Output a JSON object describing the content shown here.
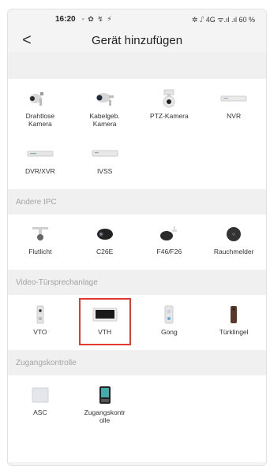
{
  "status_bar": {
    "time": "16:20",
    "left_icons": "◦ ✿ ↯ ⚡",
    "right_text": "✲ ⑀ 4G ᯤ.ıl .ıl 60 %"
  },
  "header": {
    "back_label": "<",
    "title": "Gerät hinzufügen"
  },
  "groups": [
    {
      "header": "",
      "items": [
        {
          "label_lines": [
            "Drahtlose",
            "Kamera"
          ],
          "icon": "wireless-camera-icon"
        },
        {
          "label_lines": [
            "Kabelgeb.",
            "Kamera"
          ],
          "icon": "wired-camera-icon"
        },
        {
          "label_lines": [
            "PTZ-Kamera"
          ],
          "icon": "ptz-camera-icon"
        },
        {
          "label_lines": [
            "NVR"
          ],
          "icon": "nvr-icon"
        },
        {
          "label_lines": [
            "DVR/XVR"
          ],
          "icon": "dvr-icon"
        },
        {
          "label_lines": [
            "IVSS"
          ],
          "icon": "ivss-icon"
        }
      ]
    },
    {
      "header": "Andere IPC",
      "items": [
        {
          "label_lines": [
            "Flutlicht"
          ],
          "icon": "floodlight-icon"
        },
        {
          "label_lines": [
            "C26E"
          ],
          "icon": "c26e-camera-icon"
        },
        {
          "label_lines": [
            "F46/F26"
          ],
          "icon": "f46-camera-icon"
        },
        {
          "label_lines": [
            "Rauchmelder"
          ],
          "icon": "smoke-detector-icon"
        }
      ]
    },
    {
      "header": "Video-Türsprechanlage",
      "items": [
        {
          "label_lines": [
            "VTO"
          ],
          "icon": "vto-icon"
        },
        {
          "label_lines": [
            "VTH"
          ],
          "icon": "vth-icon",
          "selected": true
        },
        {
          "label_lines": [
            "Gong"
          ],
          "icon": "chime-icon"
        },
        {
          "label_lines": [
            "Türklingel"
          ],
          "icon": "doorbell-icon"
        }
      ]
    },
    {
      "header": "Zugangskontrolle",
      "items": [
        {
          "label_lines": [
            "ASC"
          ],
          "icon": "asc-icon"
        },
        {
          "label_lines": [
            "Zugangskontr",
            "olle"
          ],
          "icon": "access-control-icon"
        }
      ]
    }
  ],
  "colors": {
    "selection_border": "#e23a30",
    "section_header_text": "#a3a3a3",
    "page_background": "#f0f0f0"
  }
}
